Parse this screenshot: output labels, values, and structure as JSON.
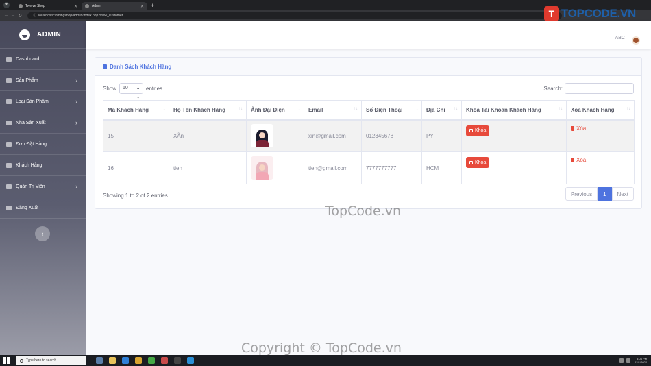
{
  "browser": {
    "tabs": [
      {
        "title": "Twelve Shop",
        "active": false
      },
      {
        "title": "Admin",
        "active": true
      }
    ],
    "url": "localhost/clothingshop/admin/index.php?view_customer"
  },
  "watermark": {
    "logo_text": "TOPCODE.VN",
    "text_center": "TopCode.vn",
    "text_bottom": "Copyright © TopCode.vn"
  },
  "sidebar": {
    "brand": "ADMIN",
    "items": [
      {
        "label": "Dashboard",
        "icon": "dashboard-icon",
        "has_submenu": false
      },
      {
        "label": "Sản Phẩm",
        "icon": "product-icon",
        "has_submenu": true
      },
      {
        "label": "Loại Sản Phẩm",
        "icon": "category-icon",
        "has_submenu": true
      },
      {
        "label": "Nhà Sản Xuất",
        "icon": "manufacturer-icon",
        "has_submenu": true
      },
      {
        "label": "Đơn Đặt Hàng",
        "icon": "order-icon",
        "has_submenu": false
      },
      {
        "label": "Khách Hàng",
        "icon": "customer-icon",
        "has_submenu": false
      },
      {
        "label": "Quản Trị Viên",
        "icon": "admin-user-icon",
        "has_submenu": true
      },
      {
        "label": "Đăng Xuất",
        "icon": "logout-icon",
        "has_submenu": false
      }
    ],
    "toggle_icon": "‹"
  },
  "topbar": {
    "username": "ABC"
  },
  "card": {
    "title": "Danh Sách Khách Hàng",
    "show_label": "Show",
    "page_size": "10",
    "entries_label": "entries",
    "search_label": "Search:",
    "columns": [
      "Mã Khách Hàng",
      "Họ Tên Khách Hàng",
      "Ảnh Đại Diện",
      "Email",
      "Số Điện Thoại",
      "Địa Chỉ",
      "Khóa Tài Khoản Khách Hàng",
      "Xóa Khách Hàng"
    ],
    "rows": [
      {
        "id": "15",
        "name": "XÃn",
        "email": "xin@gmail.com",
        "phone": "012345678",
        "address": "PY",
        "lock_label": "Khóa",
        "delete_label": "Xóa",
        "avatar_colors": {
          "hair": "#1c1c2e",
          "body": "#7b2436"
        }
      },
      {
        "id": "16",
        "name": "tien",
        "email": "tien@gmail.com",
        "phone": "7777777777",
        "address": "HCM",
        "lock_label": "Khóa",
        "delete_label": "Xóa",
        "avatar_colors": {
          "hair": "#e8b8c0",
          "body": "#f2a7b5"
        }
      }
    ],
    "info": "Showing 1 to 2 of 2 entries",
    "pagination": {
      "previous": "Previous",
      "current": "1",
      "next": "Next"
    }
  },
  "taskbar": {
    "search_placeholder": "Type here to search",
    "time": "4:04 PM",
    "date": "12/1/2024"
  },
  "colors": {
    "primary": "#4e73df",
    "danger": "#e74a3b",
    "sidebar": "#48495b"
  }
}
